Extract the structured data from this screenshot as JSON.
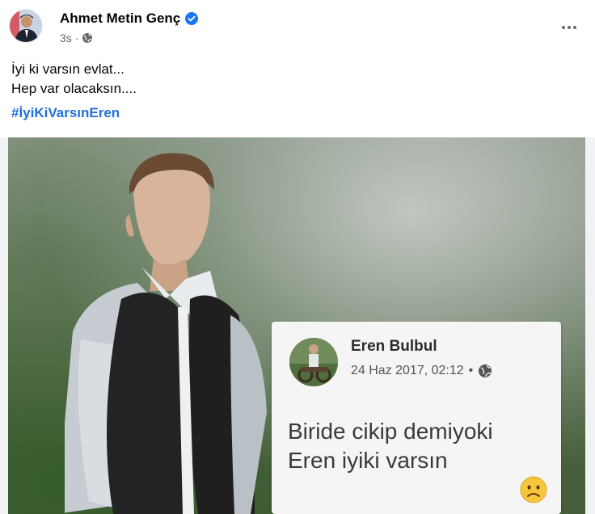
{
  "post": {
    "author": "Ahmet Metin Genç",
    "time": "3s",
    "separator": "·",
    "lines": [
      "İyi ki varsın evlat...",
      "Hep var olacaksın...."
    ],
    "hashtag": "#İyiKiVarsınEren"
  },
  "photo": {
    "card": {
      "name": "Eren Bulbul",
      "date": "24 Haz 2017, 02:12",
      "separator": "•",
      "line1": "Biride cikip demiyoki",
      "line2": "Eren iyiki varsın"
    }
  },
  "icons": {
    "verified": "verified-badge-icon",
    "privacy": "globe-icon",
    "more": "more-options-icon",
    "emoji": "sad-face-emoji"
  },
  "colors": {
    "hashtag": "#216fdb",
    "verified": "#1877f2",
    "meta": "#65676b"
  }
}
